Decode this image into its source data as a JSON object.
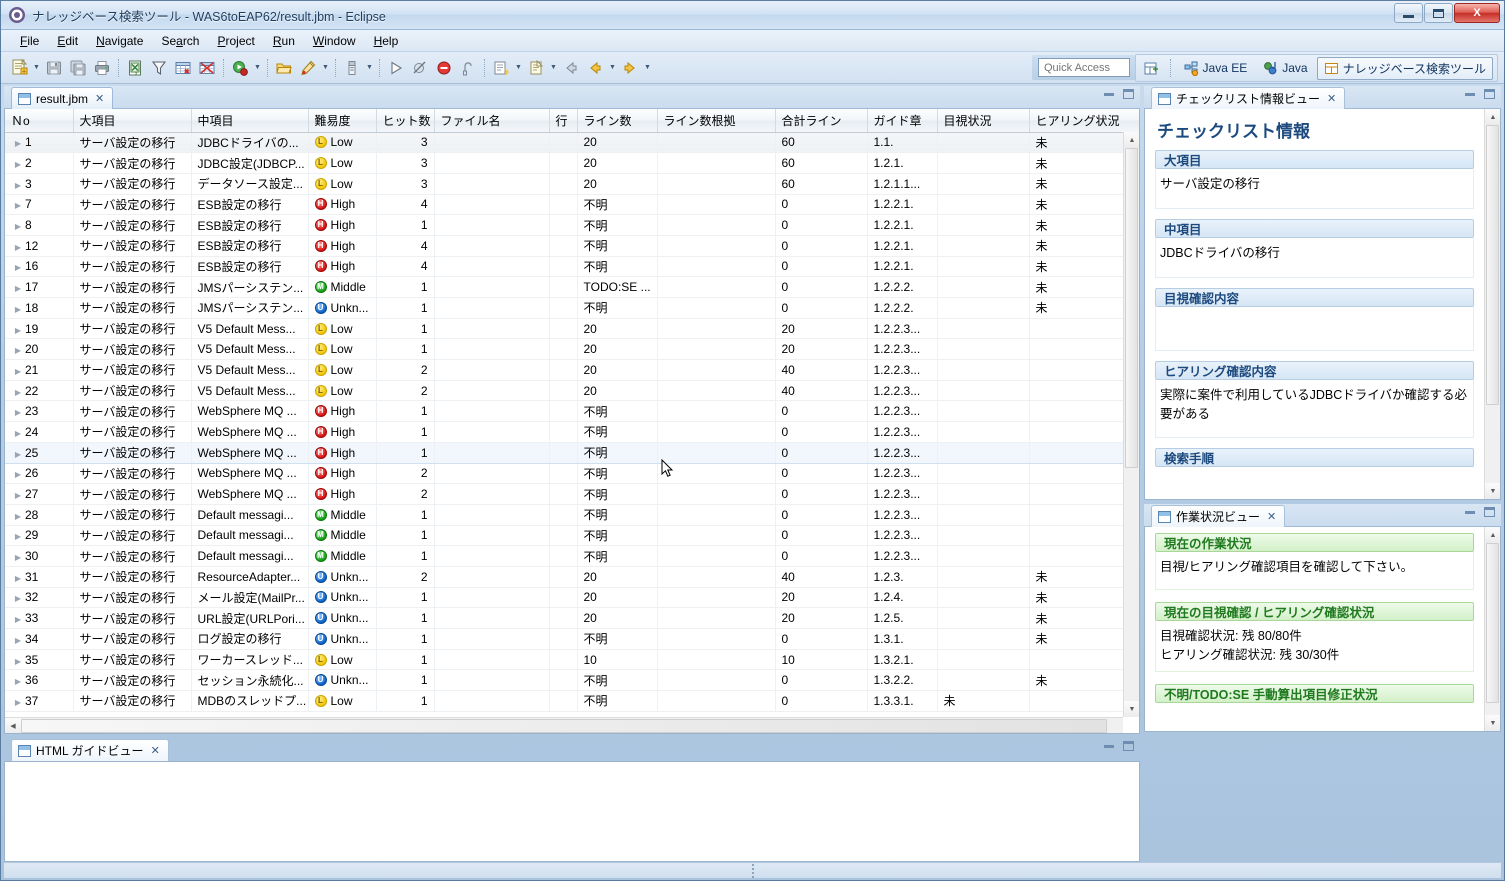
{
  "window": {
    "title": "ナレッジベース検索ツール - WAS6toEAP62/result.jbm - Eclipse",
    "icon": "eclipse-app-icon",
    "minimize_label": "",
    "maximize_label": "",
    "close_label": "X"
  },
  "menubar": {
    "items": [
      {
        "label": "File",
        "mnemonic": "F"
      },
      {
        "label": "Edit",
        "mnemonic": "E"
      },
      {
        "label": "Navigate",
        "mnemonic": "N"
      },
      {
        "label": "Search",
        "mnemonic": "a"
      },
      {
        "label": "Project",
        "mnemonic": "P"
      },
      {
        "label": "Run",
        "mnemonic": "R"
      },
      {
        "label": "Window",
        "mnemonic": "W"
      },
      {
        "label": "Help",
        "mnemonic": "H"
      }
    ]
  },
  "toolbar": {
    "buttons": [
      {
        "name": "new-wizard-icon"
      },
      {
        "name": "new-wizard-dropdown-icon"
      },
      {
        "name": "save-icon"
      },
      {
        "name": "save-all-icon"
      },
      {
        "name": "print-icon"
      },
      {
        "name": "excel-export-icon"
      },
      {
        "name": "filter-icon"
      },
      {
        "name": "table-add-icon"
      },
      {
        "name": "table-delete-icon"
      },
      {
        "name": "debug-icon"
      },
      {
        "name": "debug-dropdown-icon"
      },
      {
        "name": "open-resource-icon"
      },
      {
        "name": "run-external-icon"
      },
      {
        "name": "run-external-dropdown-icon"
      },
      {
        "name": "perspective-icon"
      },
      {
        "name": "perspective-dropdown-icon"
      },
      {
        "name": "resume-icon"
      },
      {
        "name": "skip-breakpoints-icon"
      },
      {
        "name": "terminate-icon"
      },
      {
        "name": "disconnect-icon"
      },
      {
        "name": "next-annotation-icon"
      },
      {
        "name": "next-annotation-dropdown-icon"
      },
      {
        "name": "previous-edit-icon"
      },
      {
        "name": "previous-edit-dropdown-icon"
      },
      {
        "name": "back-icon"
      },
      {
        "name": "back-history-icon"
      },
      {
        "name": "back-dropdown-icon"
      },
      {
        "name": "forward-icon"
      },
      {
        "name": "forward-dropdown-icon"
      }
    ]
  },
  "quick_access": {
    "placeholder": "Quick Access",
    "value": ""
  },
  "perspectives": {
    "open_perspective_label": "",
    "items": [
      {
        "label": "Java EE",
        "icon": "java-ee-perspective-icon",
        "active": false
      },
      {
        "label": "Java",
        "icon": "java-perspective-icon",
        "active": false
      },
      {
        "label": "ナレッジベース検索ツール",
        "icon": "knowledge-base-perspective-icon",
        "active": true
      }
    ]
  },
  "editor": {
    "tab_label": "result.jbm",
    "tab_close": "✕",
    "table": {
      "columns": [
        "Ｎo",
        "大項目",
        "中項目",
        "難易度",
        "ヒット数",
        "ファイル名",
        "行",
        "ライン数",
        "ライン数根拠",
        "合計ライン",
        "ガイド章",
        "目視状況",
        "ヒアリング状況"
      ],
      "rows": [
        {
          "no": "1",
          "major": "サーバ設定の移行",
          "minor": "JDBCドライバの...",
          "difficulty": "Low",
          "sev": "low",
          "hits": "3",
          "file": "",
          "line": "",
          "lines": "20",
          "basis": "",
          "total": "60",
          "chapter": "1.1.",
          "visual": "",
          "hearing": "未"
        },
        {
          "no": "2",
          "major": "サーバ設定の移行",
          "minor": "JDBC設定(JDBCP...",
          "difficulty": "Low",
          "sev": "low",
          "hits": "3",
          "file": "",
          "line": "",
          "lines": "20",
          "basis": "",
          "total": "60",
          "chapter": "1.2.1.",
          "visual": "",
          "hearing": "未"
        },
        {
          "no": "3",
          "major": "サーバ設定の移行",
          "minor": "データソース設定...",
          "difficulty": "Low",
          "sev": "low",
          "hits": "3",
          "file": "",
          "line": "",
          "lines": "20",
          "basis": "",
          "total": "60",
          "chapter": "1.2.1.1...",
          "visual": "",
          "hearing": "未"
        },
        {
          "no": "7",
          "major": "サーバ設定の移行",
          "minor": "ESB設定の移行",
          "difficulty": "High",
          "sev": "high",
          "hits": "4",
          "file": "",
          "line": "",
          "lines": "不明",
          "basis": "",
          "total": "0",
          "chapter": "1.2.2.1.",
          "visual": "",
          "hearing": "未"
        },
        {
          "no": "8",
          "major": "サーバ設定の移行",
          "minor": "ESB設定の移行",
          "difficulty": "High",
          "sev": "high",
          "hits": "1",
          "file": "",
          "line": "",
          "lines": "不明",
          "basis": "",
          "total": "0",
          "chapter": "1.2.2.1.",
          "visual": "",
          "hearing": "未"
        },
        {
          "no": "12",
          "major": "サーバ設定の移行",
          "minor": "ESB設定の移行",
          "difficulty": "High",
          "sev": "high",
          "hits": "4",
          "file": "",
          "line": "",
          "lines": "不明",
          "basis": "",
          "total": "0",
          "chapter": "1.2.2.1.",
          "visual": "",
          "hearing": "未"
        },
        {
          "no": "16",
          "major": "サーバ設定の移行",
          "minor": "ESB設定の移行",
          "difficulty": "High",
          "sev": "high",
          "hits": "4",
          "file": "",
          "line": "",
          "lines": "不明",
          "basis": "",
          "total": "0",
          "chapter": "1.2.2.1.",
          "visual": "",
          "hearing": "未"
        },
        {
          "no": "17",
          "major": "サーバ設定の移行",
          "minor": "JMSパーシステン...",
          "difficulty": "Middle",
          "sev": "mid",
          "hits": "1",
          "file": "",
          "line": "",
          "lines": "TODO:SE ...",
          "basis": "",
          "total": "0",
          "chapter": "1.2.2.2.",
          "visual": "",
          "hearing": "未"
        },
        {
          "no": "18",
          "major": "サーバ設定の移行",
          "minor": "JMSパーシステン...",
          "difficulty": "Unkn...",
          "sev": "unk",
          "hits": "1",
          "file": "",
          "line": "",
          "lines": "不明",
          "basis": "",
          "total": "0",
          "chapter": "1.2.2.2.",
          "visual": "",
          "hearing": "未"
        },
        {
          "no": "19",
          "major": "サーバ設定の移行",
          "minor": "V5 Default Mess...",
          "difficulty": "Low",
          "sev": "low",
          "hits": "1",
          "file": "",
          "line": "",
          "lines": "20",
          "basis": "",
          "total": "20",
          "chapter": "1.2.2.3...",
          "visual": "",
          "hearing": ""
        },
        {
          "no": "20",
          "major": "サーバ設定の移行",
          "minor": "V5 Default Mess...",
          "difficulty": "Low",
          "sev": "low",
          "hits": "1",
          "file": "",
          "line": "",
          "lines": "20",
          "basis": "",
          "total": "20",
          "chapter": "1.2.2.3...",
          "visual": "",
          "hearing": ""
        },
        {
          "no": "21",
          "major": "サーバ設定の移行",
          "minor": "V5 Default Mess...",
          "difficulty": "Low",
          "sev": "low",
          "hits": "2",
          "file": "",
          "line": "",
          "lines": "20",
          "basis": "",
          "total": "40",
          "chapter": "1.2.2.3...",
          "visual": "",
          "hearing": ""
        },
        {
          "no": "22",
          "major": "サーバ設定の移行",
          "minor": "V5 Default Mess...",
          "difficulty": "Low",
          "sev": "low",
          "hits": "2",
          "file": "",
          "line": "",
          "lines": "20",
          "basis": "",
          "total": "40",
          "chapter": "1.2.2.3...",
          "visual": "",
          "hearing": ""
        },
        {
          "no": "23",
          "major": "サーバ設定の移行",
          "minor": "WebSphere MQ ...",
          "difficulty": "High",
          "sev": "high",
          "hits": "1",
          "file": "",
          "line": "",
          "lines": "不明",
          "basis": "",
          "total": "0",
          "chapter": "1.2.2.3...",
          "visual": "",
          "hearing": ""
        },
        {
          "no": "24",
          "major": "サーバ設定の移行",
          "minor": "WebSphere MQ ...",
          "difficulty": "High",
          "sev": "high",
          "hits": "1",
          "file": "",
          "line": "",
          "lines": "不明",
          "basis": "",
          "total": "0",
          "chapter": "1.2.2.3...",
          "visual": "",
          "hearing": ""
        },
        {
          "no": "25",
          "major": "サーバ設定の移行",
          "minor": "WebSphere MQ ...",
          "difficulty": "High",
          "sev": "high",
          "hits": "1",
          "file": "",
          "line": "",
          "lines": "不明",
          "basis": "",
          "total": "0",
          "chapter": "1.2.2.3...",
          "visual": "",
          "hearing": "",
          "selected": true
        },
        {
          "no": "26",
          "major": "サーバ設定の移行",
          "minor": "WebSphere MQ ...",
          "difficulty": "High",
          "sev": "high",
          "hits": "2",
          "file": "",
          "line": "",
          "lines": "不明",
          "basis": "",
          "total": "0",
          "chapter": "1.2.2.3...",
          "visual": "",
          "hearing": ""
        },
        {
          "no": "27",
          "major": "サーバ設定の移行",
          "minor": "WebSphere MQ ...",
          "difficulty": "High",
          "sev": "high",
          "hits": "2",
          "file": "",
          "line": "",
          "lines": "不明",
          "basis": "",
          "total": "0",
          "chapter": "1.2.2.3...",
          "visual": "",
          "hearing": ""
        },
        {
          "no": "28",
          "major": "サーバ設定の移行",
          "minor": "Default messagi...",
          "difficulty": "Middle",
          "sev": "mid",
          "hits": "1",
          "file": "",
          "line": "",
          "lines": "不明",
          "basis": "",
          "total": "0",
          "chapter": "1.2.2.3...",
          "visual": "",
          "hearing": ""
        },
        {
          "no": "29",
          "major": "サーバ設定の移行",
          "minor": "Default messagi...",
          "difficulty": "Middle",
          "sev": "mid",
          "hits": "1",
          "file": "",
          "line": "",
          "lines": "不明",
          "basis": "",
          "total": "0",
          "chapter": "1.2.2.3...",
          "visual": "",
          "hearing": ""
        },
        {
          "no": "30",
          "major": "サーバ設定の移行",
          "minor": "Default messagi...",
          "difficulty": "Middle",
          "sev": "mid",
          "hits": "1",
          "file": "",
          "line": "",
          "lines": "不明",
          "basis": "",
          "total": "0",
          "chapter": "1.2.2.3...",
          "visual": "",
          "hearing": ""
        },
        {
          "no": "31",
          "major": "サーバ設定の移行",
          "minor": "ResourceAdapter...",
          "difficulty": "Unkn...",
          "sev": "unk",
          "hits": "2",
          "file": "",
          "line": "",
          "lines": "20",
          "basis": "",
          "total": "40",
          "chapter": "1.2.3.",
          "visual": "",
          "hearing": "未"
        },
        {
          "no": "32",
          "major": "サーバ設定の移行",
          "minor": "メール設定(MailPr...",
          "difficulty": "Unkn...",
          "sev": "unk",
          "hits": "1",
          "file": "",
          "line": "",
          "lines": "20",
          "basis": "",
          "total": "20",
          "chapter": "1.2.4.",
          "visual": "",
          "hearing": "未"
        },
        {
          "no": "33",
          "major": "サーバ設定の移行",
          "minor": "URL設定(URLPori...",
          "difficulty": "Unkn...",
          "sev": "unk",
          "hits": "1",
          "file": "",
          "line": "",
          "lines": "20",
          "basis": "",
          "total": "20",
          "chapter": "1.2.5.",
          "visual": "",
          "hearing": "未"
        },
        {
          "no": "34",
          "major": "サーバ設定の移行",
          "minor": "ログ設定の移行",
          "difficulty": "Unkn...",
          "sev": "unk",
          "hits": "1",
          "file": "",
          "line": "",
          "lines": "不明",
          "basis": "",
          "total": "0",
          "chapter": "1.3.1.",
          "visual": "",
          "hearing": "未"
        },
        {
          "no": "35",
          "major": "サーバ設定の移行",
          "minor": "ワーカースレッド...",
          "difficulty": "Low",
          "sev": "low",
          "hits": "1",
          "file": "",
          "line": "",
          "lines": "10",
          "basis": "",
          "total": "10",
          "chapter": "1.3.2.1.",
          "visual": "",
          "hearing": ""
        },
        {
          "no": "36",
          "major": "サーバ設定の移行",
          "minor": "セッション永続化...",
          "difficulty": "Unkn...",
          "sev": "unk",
          "hits": "1",
          "file": "",
          "line": "",
          "lines": "不明",
          "basis": "",
          "total": "0",
          "chapter": "1.3.2.2.",
          "visual": "",
          "hearing": "未"
        },
        {
          "no": "37",
          "major": "サーバ設定の移行",
          "minor": "MDBのスレッドプ...",
          "difficulty": "Low",
          "sev": "low",
          "hits": "1",
          "file": "",
          "line": "",
          "lines": "不明",
          "basis": "",
          "total": "0",
          "chapter": "1.3.3.1.",
          "visual": "未",
          "hearing": ""
        }
      ]
    }
  },
  "html_guide_view": {
    "tab_label": "HTML ガイドビュー",
    "tab_close": "✕",
    "content": ""
  },
  "checklist_view": {
    "tab_label": "チェックリスト情報ビュー",
    "tab_close": "✕",
    "heading": "チェックリスト情報",
    "sections": [
      {
        "title": "大項目",
        "body": "サーバ設定の移行"
      },
      {
        "title": "中項目",
        "body": "JDBCドライバの移行"
      },
      {
        "title": "目視確認内容",
        "body": ""
      },
      {
        "title": "ヒアリング確認内容",
        "body": "実際に案件で利用しているJDBCドライバか確認する必要がある"
      },
      {
        "title": "検索手順",
        "body": ""
      }
    ]
  },
  "status_view": {
    "tab_label": "作業状況ビュー",
    "tab_close": "✕",
    "sections": [
      {
        "title": "現在の作業状況",
        "lines": [
          "目視/ヒアリング確認項目を確認して下さい。"
        ]
      },
      {
        "title": "現在の目視確認 / ヒアリング確認状況",
        "lines": [
          "目視確認状況: 残 80/80件",
          "ヒアリング確認状況: 残 30/30件"
        ]
      },
      {
        "title": "不明/TODO:SE 手動算出項目修正状況",
        "lines": []
      }
    ]
  },
  "colors": {
    "accent_blue": "#1c4a7e",
    "accent_green": "#1f7a1f",
    "sev_low": "#f2c600",
    "sev_high": "#d8120f",
    "sev_middle": "#15a015",
    "sev_unknown": "#0a62c8"
  }
}
